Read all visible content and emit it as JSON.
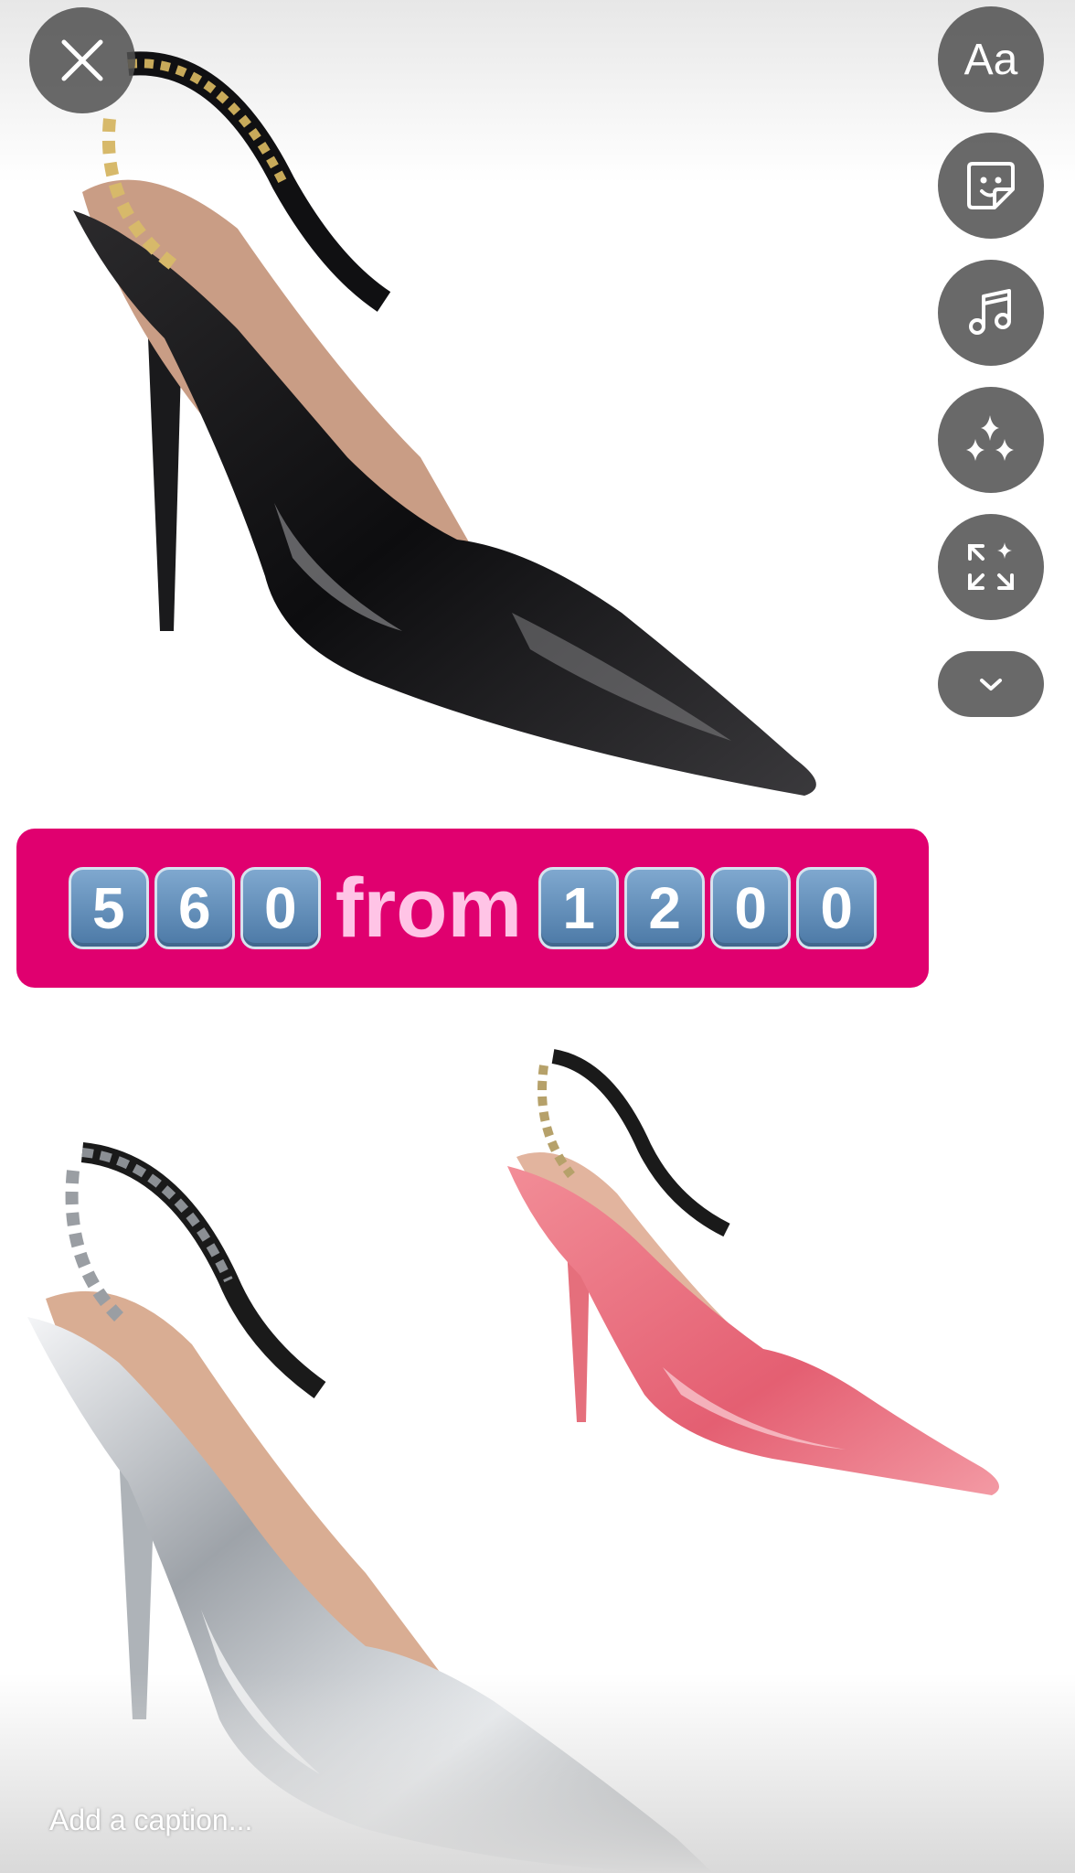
{
  "sticker": {
    "left_digits": [
      "5",
      "6",
      "0"
    ],
    "word": "from",
    "right_digits": [
      "1",
      "2",
      "0",
      "0"
    ],
    "background": "#e0006f"
  },
  "toolbar": {
    "text_label": "Aa",
    "icons": [
      "close-icon",
      "text-icon",
      "sticker-icon",
      "music-icon",
      "sparkle-icon",
      "resize-icon",
      "chevron-down-icon"
    ]
  },
  "caption": {
    "placeholder": "Add a caption..."
  },
  "products": [
    {
      "name": "black-patent-slingback-pump",
      "color": "#111111"
    },
    {
      "name": "pink-patent-slingback-pump",
      "color": "#e8707e"
    },
    {
      "name": "silver-metallic-slingback-pump",
      "color": "#c9cdd2"
    }
  ]
}
